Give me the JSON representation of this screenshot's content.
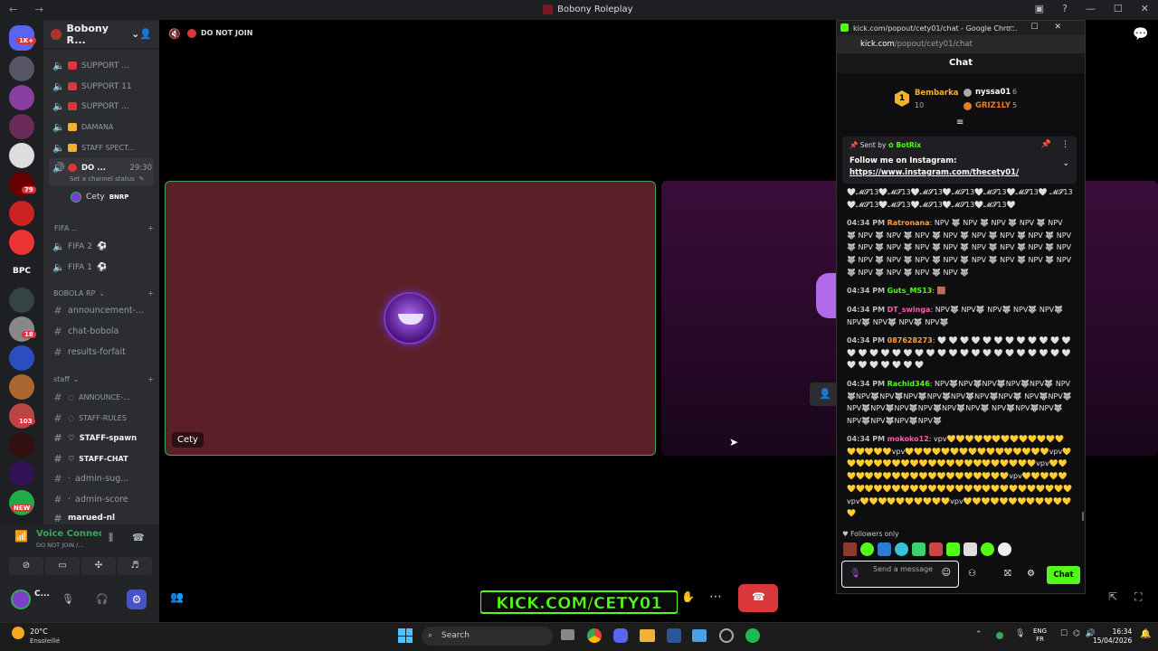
{
  "window": {
    "title": "Bobony Roleplay"
  },
  "server": {
    "name": "Bobony R..."
  },
  "rail_badges": [
    "1K+",
    "79",
    "18",
    "103",
    "NEW"
  ],
  "rail_text": "BPC",
  "channels": [
    {
      "icon": "speaker",
      "label": "SUPPORT ...",
      "sq": "#da373c"
    },
    {
      "icon": "speaker",
      "label": "SUPPORT 11",
      "sq": "#da373c"
    },
    {
      "icon": "speaker",
      "label": "SUPPORT ...",
      "sq": "#da373c"
    },
    {
      "icon": "speaker",
      "label": "DAMANA",
      "sq": "#f0b232"
    },
    {
      "icon": "speaker",
      "label": "STAFF SPECT...",
      "sq": "#f0b232"
    }
  ],
  "active_channel": {
    "label": "DO ...",
    "time": "29:30",
    "status": "Set a channel status"
  },
  "member": {
    "name": "Cety",
    "tag": "BNRP"
  },
  "fifa": {
    "category": "FIFA ...",
    "items": [
      "FIFA 2",
      "FIFA 1"
    ]
  },
  "bobola": {
    "category": "BOBOLA RP",
    "items": [
      "announcement-...",
      "chat-bobola",
      "results-forfait"
    ]
  },
  "staff": {
    "category": "staff",
    "items": [
      "ANNOUNCE-...",
      "STAFF-RULES",
      "STAFF-spawn",
      "STAFF-CHAT",
      "admin-sug...",
      "admin-score",
      "marued-nl"
    ]
  },
  "voice": {
    "title": "Voice Connected",
    "sub": "DO NOT JOIN /..."
  },
  "user": {
    "name": "C..."
  },
  "stage": {
    "channel_title": "DO NOT JOIN",
    "tile_name": "Cety"
  },
  "kick": {
    "banner": "KICK.COM/CETY01"
  },
  "chat": {
    "window_title": "kick.com/popout/cety01/chat - Google Chro...",
    "url_host": "kick.com",
    "url_path": "/popout/cety01/chat",
    "header": "Chat",
    "leaderboard": [
      {
        "rank": "1",
        "name": "Bembarka",
        "count": "10"
      },
      {
        "name": "nyssa01",
        "count": "6"
      },
      {
        "name": "GRIZ1LY",
        "count": "5"
      }
    ],
    "pinned": {
      "sent_by": "Sent by",
      "bot": "BotRix",
      "text": "Follow me on Instagram:",
      "link": "https://www.instagram.com/thecety01/"
    },
    "messages": [
      {
        "time": "",
        "user": "",
        "color": "#fff",
        "text": "🤍𝓜𝓢13🤍𝓜𝓢13🤍𝓜𝓢13🤍𝓜𝓢13🤍𝓜𝓢13🤍𝓜𝓢13🤍 𝓜𝓢13🤍𝓜𝓢13🤍𝓜𝓢13🤍𝓜𝓢13🤍𝓜𝓢13🤍𝓜𝓢13🤍"
      },
      {
        "time": "04:34 PM",
        "user": "Ratronana",
        "color": "#ff9f43",
        "text": "NPV 🐺 NPV 🐺 NPV 🐺 NPV 🐺 NPV 🐺 NPV 🐺 NPV 🐺 NPV 🐺 NPV 🐺 NPV 🐺 NPV 🐺 NPV 🐺 NPV 🐺 NPV 🐺 NPV 🐺 NPV 🐺 NPV 🐺 NPV 🐺 NPV 🐺 NPV 🐺 NPV 🐺 NPV 🐺 NPV 🐺 NPV 🐺 NPV 🐺 NPV 🐺 NPV 🐺 NPV 🐺 NPV 🐺 NPV 🐺 NPV 🐺 NPV 🐺 NPV 🐺"
      },
      {
        "time": "04:34 PM",
        "user": "Guts_MS13",
        "color": "#53fc18",
        "text": "🟫"
      },
      {
        "time": "04:34 PM",
        "user": "DT_swinga",
        "color": "#ff5ab4",
        "text": "NPV🐺 NPV🐺 NPV🐺 NPV🐺 NPV🐺 NPV🐺 NPV🐺 NPV🐺 NPV🐺"
      },
      {
        "time": "04:34 PM",
        "user": "087628273",
        "color": "#ff9f43",
        "text": "🤍 🤍 🤍 🤍 🤍 🤍 🤍 🤍 🤍 🤍 🤍 🤍 🤍 🤍 🤍 🤍 🤍 🤍 🤍 🤍 🤍 🤍 🤍 🤍 🤍 🤍 🤍 🤍 🤍 🤍 🤍 🤍 🤍 🤍 🤍 🤍 🤍 🤍 🤍"
      },
      {
        "time": "04:34 PM",
        "user": "Rachid346",
        "color": "#53fc18",
        "text": "NPV🐺NPV🐺NPV🐺NPV🐺NPV🐺 NPV🐺NPV🐺NPV🐺NPV🐺NPV🐺NPV🐺NPV🐺NPV🐺 NPV🐺NPV🐺NPV🐺NPV🐺NPV🐺NPV🐺NPV🐺NPV🐺 NPV🐺NPV🐺NPV🐺NPV🐺NPV🐺NPV🐺NPV🐺"
      },
      {
        "time": "04:34 PM",
        "user": "mokoko12",
        "color": "#ff5ab4",
        "text": "vpv💛💛💛💛💛💛💛💛💛💛💛💛💛💛💛💛💛💛vpv💛💛💛💛💛💛💛💛💛💛💛💛💛💛💛💛vpv💛💛💛💛💛💛💛💛💛💛💛💛💛💛💛💛💛💛💛💛💛💛vpv💛💛💛💛💛💛💛💛💛💛💛💛💛💛💛💛💛💛💛💛vpv💛💛💛💛💛💛💛💛💛💛💛💛💛💛💛💛💛💛💛💛💛💛💛💛💛💛💛💛💛💛vpv💛💛💛💛💛💛💛💛💛💛vpv💛💛💛💛💛💛💛💛💛💛💛💛💛"
      }
    ],
    "followers_only": "Followers only",
    "placeholder": "Send a message",
    "chat_button": "Chat"
  },
  "taskbar": {
    "temp": "20°C",
    "weather": "Ensoleillé",
    "search": "Search",
    "lang1": "ENG",
    "lang2": "FR",
    "time": "16:34",
    "date": "15/04/2026"
  }
}
